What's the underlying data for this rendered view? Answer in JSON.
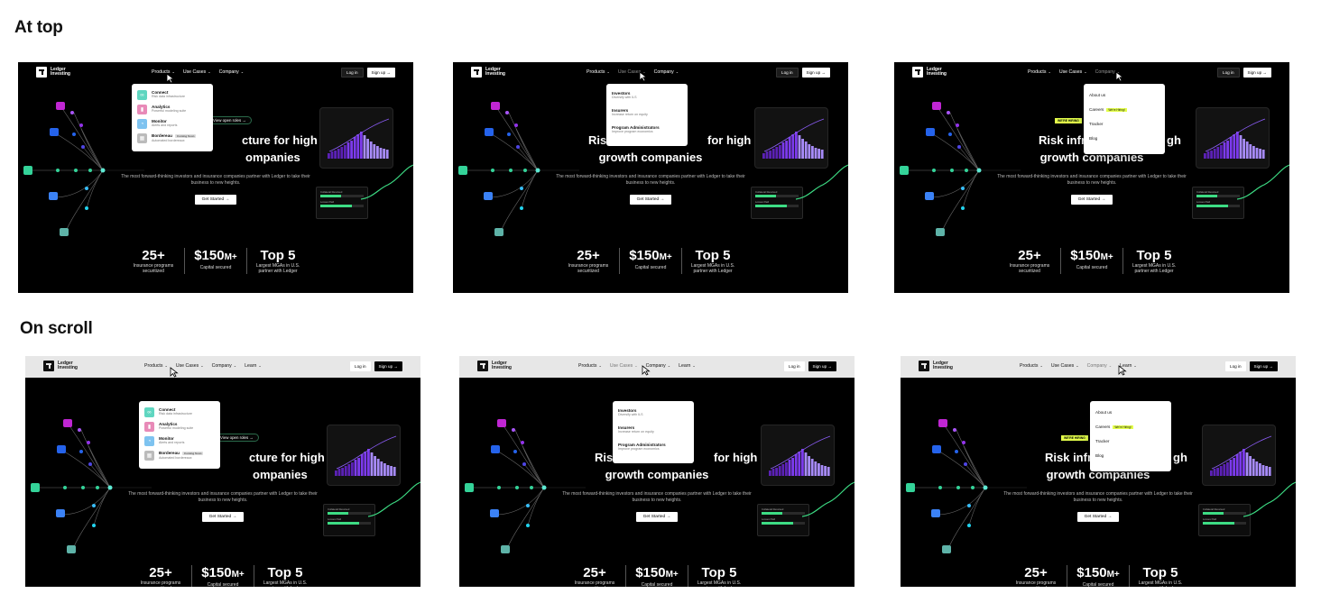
{
  "sections": {
    "top": "At top",
    "scroll": "On scroll"
  },
  "brand": {
    "name": "Ledger Investing"
  },
  "nav": {
    "products": "Products",
    "use_cases": "Use Cases",
    "company": "Company",
    "learn": "Learn",
    "login": "Log in",
    "signup": "Sign up →"
  },
  "hero": {
    "title_full_1": "Risk infrastructure for high",
    "title_full_2": "growth companies",
    "title_products_1": "cture for high",
    "title_products_2": "ompanies",
    "title_usecases_1a": "Risk in",
    "title_usecases_1b": "for high",
    "title_company_1a": "Risk infrastr",
    "title_company_1b": "gh",
    "subtitle": "The most forward-thinking investors and insurance companies partner with Ledger to take their business to new heights.",
    "cta": "Get Started →",
    "roles_pill": "View open roles →",
    "hiring_badge": "WE'RE HIRING"
  },
  "stats": [
    {
      "value": "25+",
      "suffix": "",
      "label": "Insurance programs securitized"
    },
    {
      "value": "$150",
      "suffix": "M+",
      "label": "Capital secured"
    },
    {
      "value": "Top 5",
      "suffix": "",
      "label": "Largest MGAs in U.S. partner with Ledger"
    }
  ],
  "cards": {
    "collateral": "Collateral Received",
    "losses": "Losses Paid"
  },
  "products_menu": [
    {
      "title": "Connect",
      "desc": "Risk data infrastructure",
      "color": "#5fd6c0",
      "icon": "link-icon",
      "tag": ""
    },
    {
      "title": "Analytics",
      "desc": "Powerful modeling suite",
      "color": "#e88ab8",
      "icon": "chart-icon",
      "tag": ""
    },
    {
      "title": "Monitor",
      "desc": "Alerts and reports",
      "color": "#7ec3f0",
      "icon": "bell-icon",
      "tag": ""
    },
    {
      "title": "Bordereau",
      "desc": "Automated bordereaux",
      "color": "#bbbbbb",
      "icon": "table-icon",
      "tag": "Coming Soon"
    }
  ],
  "usecases_menu": [
    {
      "title": "Investors",
      "desc": "Diversify with ILS"
    },
    {
      "title": "Insurers",
      "desc": "Increase return on equity"
    },
    {
      "title": "Program Administrators",
      "desc": "Improve program economics"
    }
  ],
  "company_menu": [
    {
      "title": "About us",
      "tag": ""
    },
    {
      "title": "Careers",
      "tag": "We're Hiring!"
    },
    {
      "title": "Tracker",
      "tag": ""
    },
    {
      "title": "Blog",
      "tag": ""
    }
  ],
  "colors": {
    "accent_green": "#3ddc84",
    "accent_purple": "#8b5cf6",
    "hiring": "#e4ff4a"
  }
}
